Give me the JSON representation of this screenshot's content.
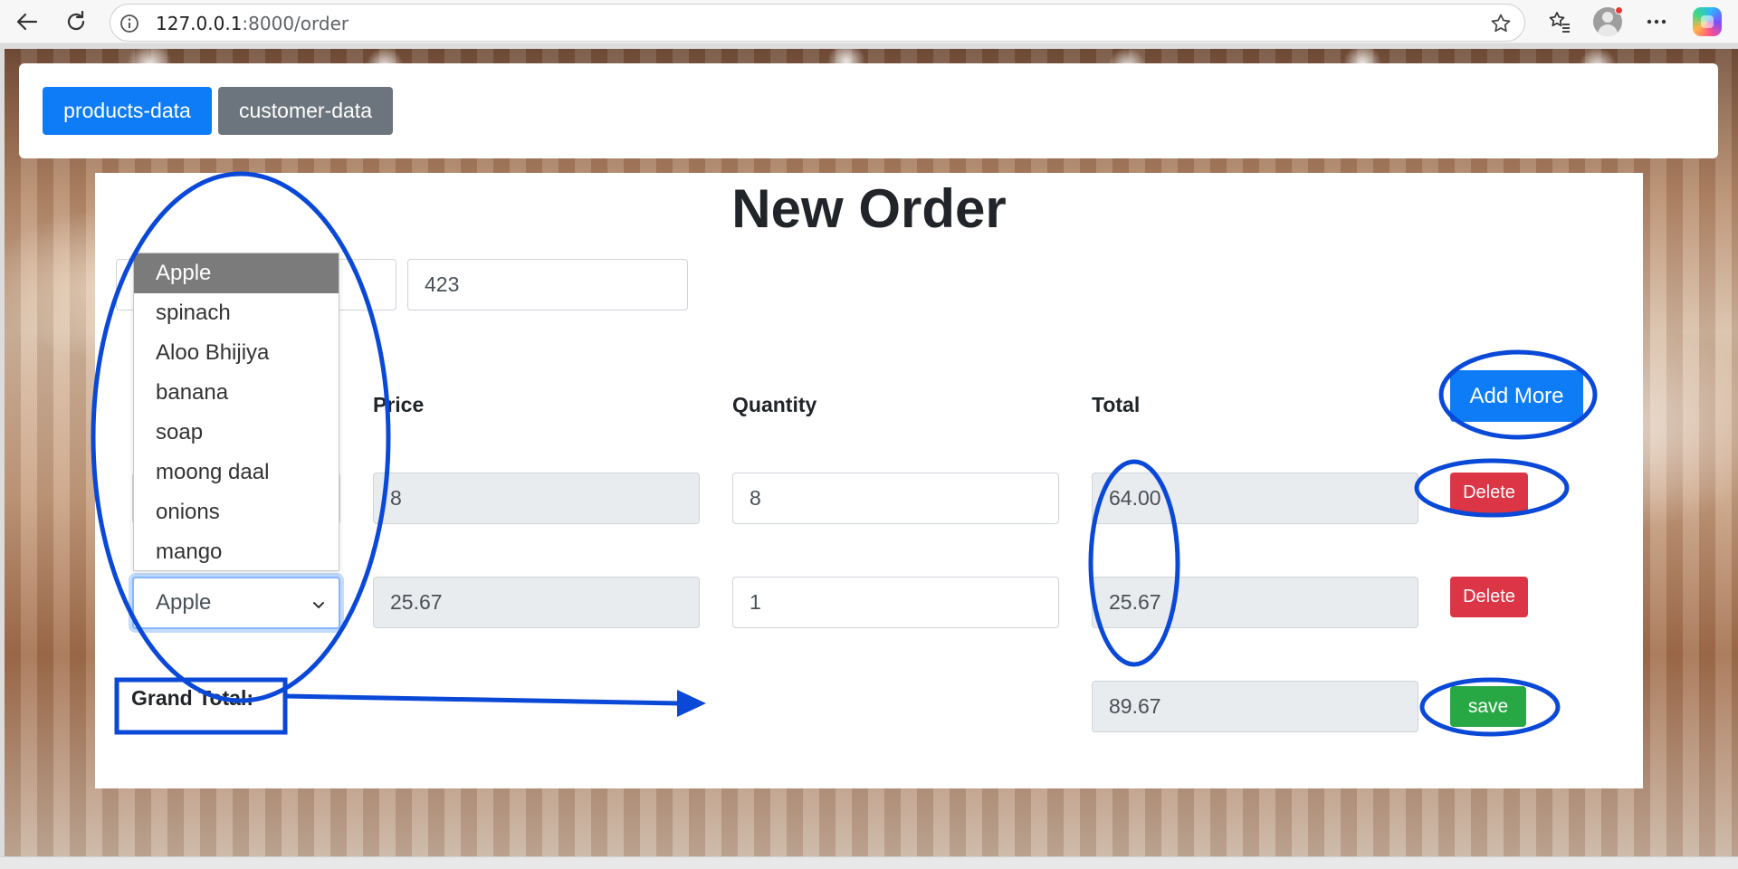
{
  "browser": {
    "url_host": "127.0.0.1",
    "url_path": ":8000/order",
    "icons": [
      "back-arrow-icon",
      "refresh-icon",
      "site-info-icon",
      "star-icon",
      "favorites-icon",
      "profile-avatar",
      "more-icon",
      "copilot-icon"
    ]
  },
  "nav": {
    "products_label": "products-data",
    "customers_label": "customer-data"
  },
  "page": {
    "title": "New Order",
    "customer_field_value": "423"
  },
  "table": {
    "headers": {
      "price": "Price",
      "quantity": "Quantity",
      "total": "Total"
    },
    "add_more_label": "Add More",
    "rows": [
      {
        "price": "8",
        "quantity": "8",
        "total": "64.00",
        "delete_label": "Delete"
      },
      {
        "product": "Apple",
        "price": "25.67",
        "quantity": "1",
        "total": "25.67",
        "delete_label": "Delete"
      }
    ]
  },
  "dropdown": {
    "options": [
      "Apple",
      "spinach",
      "Aloo Bhijiya",
      "banana",
      "soap",
      "moong daal",
      "onions",
      "mango"
    ],
    "highlighted": "Apple"
  },
  "footer": {
    "grand_total_label": "Grand Total:",
    "grand_total_value": "89.67",
    "save_label": "save"
  },
  "colors": {
    "primary": "#0d7cf6",
    "secondary": "#6c757d",
    "danger": "#dc3545",
    "success": "#28a745",
    "annotation": "#0a49d8"
  }
}
